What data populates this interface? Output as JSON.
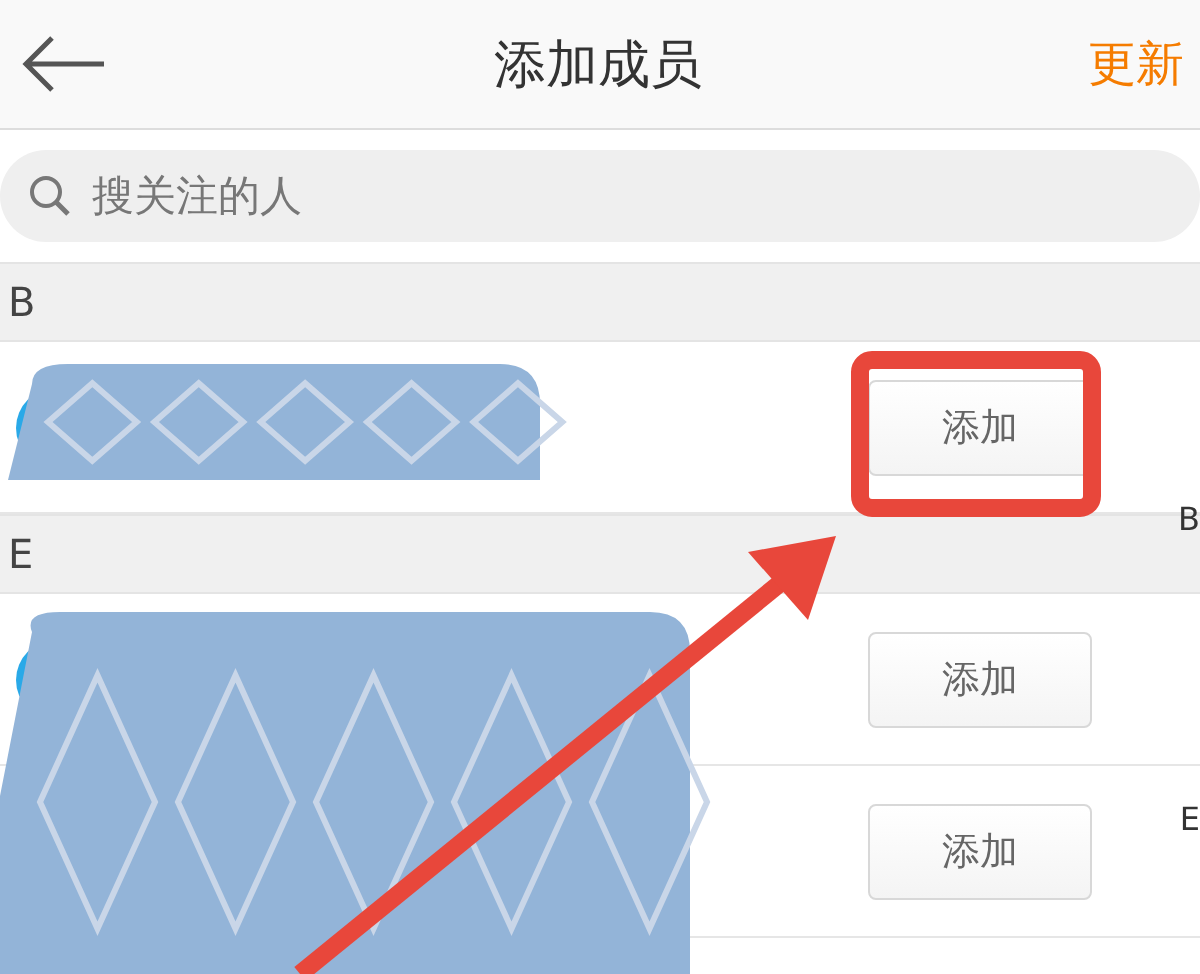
{
  "header": {
    "title": "添加成员",
    "action": "更新"
  },
  "search": {
    "placeholder": "搜关注的人"
  },
  "sections": [
    {
      "letter": "B",
      "members": [
        {
          "button": "添加"
        }
      ]
    },
    {
      "letter": "E",
      "members": [
        {
          "button": "添加"
        },
        {
          "button": "添加"
        }
      ]
    }
  ],
  "index": [
    "B",
    "E"
  ]
}
